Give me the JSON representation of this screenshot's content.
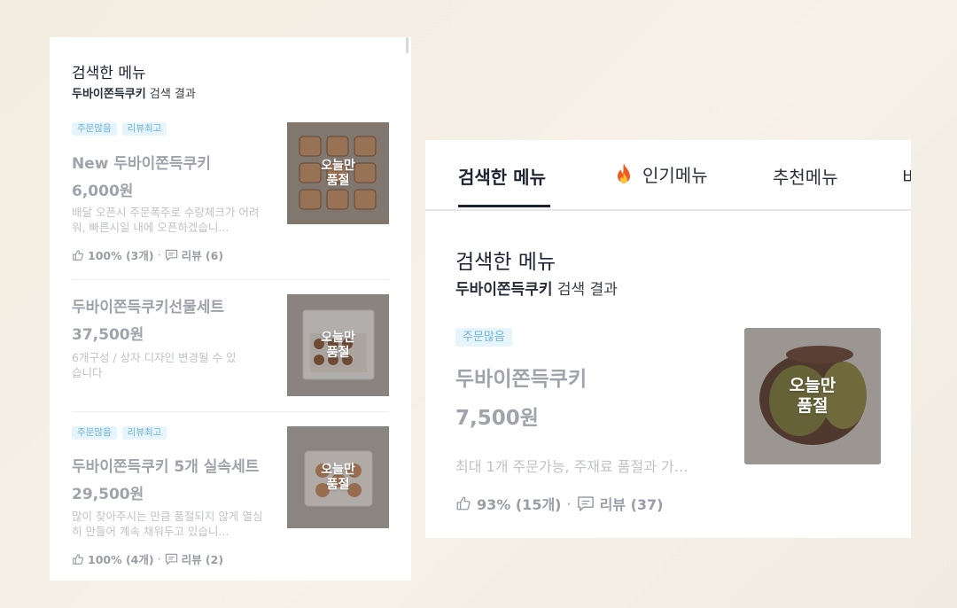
{
  "left": {
    "section_title": "검색한 메뉴",
    "query": "두바이쫀득쿠키",
    "result_suffix": " 검색 결과",
    "items": [
      {
        "badges": [
          "주문많음",
          "리뷰최고"
        ],
        "name": "New 두바이쫀득쿠키",
        "price": "6,000원",
        "description": "배달 오픈시 주문폭주로 수량체크가 어려워, 빠른시일 내에 오픈하겠습니...",
        "rating": "100% (3개)",
        "reviews": "리뷰 (6)",
        "sold_out": "오늘만\n품절"
      },
      {
        "badges": [],
        "name": "두바이쫀득쿠키선물세트",
        "price": "37,500원",
        "description": "6개구성 / 상자 디자인 변경될 수 있습니다",
        "rating": "",
        "reviews": "",
        "sold_out": "오늘만\n품절"
      },
      {
        "badges": [
          "주문많음",
          "리뷰최고"
        ],
        "name": "두바이쫀득쿠키 5개 실속세트",
        "price": "29,500원",
        "description": "많이 찾아주시는 만큼 품절되지 않게 열심히 만들어 계속 채워두고 있습니...",
        "rating": "100% (4개)",
        "reviews": "리뷰 (2)",
        "sold_out": "오늘만\n품절"
      }
    ]
  },
  "right": {
    "tabs": [
      "검색한 메뉴",
      "인기메뉴",
      "추천메뉴",
      "비"
    ],
    "active_tab": "검색한 메뉴",
    "section_title": "검색한 메뉴",
    "query": "두바이쫀득쿠키",
    "result_suffix": " 검색 결과",
    "item": {
      "badges": [
        "주문많음"
      ],
      "name": "두바이쫀득쿠키",
      "price": "7,500원",
      "description": "최대 1개 주문가능, 주재료 품절과 가…",
      "rating": "93% (15개)",
      "reviews": "리뷰 (37)",
      "sold_out": "오늘만\n품절"
    }
  },
  "colors": {
    "badge_bg": "#e6f4fc",
    "badge_text": "#6fb3dc",
    "muted_text": "#a0a3ab",
    "active_tab_underline": "#1f2233",
    "fire_icon": "#f05a22"
  },
  "icons": [
    "thumbs-up-icon",
    "review-chat-icon",
    "fire-icon"
  ]
}
